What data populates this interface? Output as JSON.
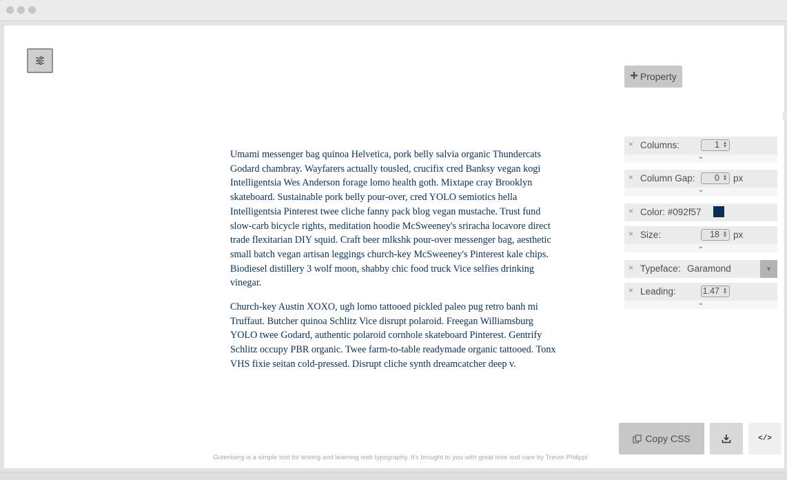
{
  "toolbar": {
    "add_property_label": "Property",
    "add_property_icon": "plus-icon",
    "settings_icon": "sliders-icon"
  },
  "content": {
    "paragraphs": [
      "Umami messenger bag quinoa Helvetica, pork belly salvia organic Thundercats Godard chambray. Wayfarers actually tousled, crucifix cred Banksy vegan kogi Intelligentsia Wes Anderson forage lomo health goth. Mixtape cray Brooklyn skateboard. Sustainable pork belly pour-over, cred YOLO semiotics hella Intelligentsia Pinterest twee cliche fanny pack blog vegan mustache. Trust fund slow-carb bicycle rights, meditation hoodie McSweeney's sriracha locavore direct trade flexitarian DIY squid. Craft beer mlkshk pour-over messenger bag, aesthetic small batch vegan artisan leggings church-key McSweeney's Pinterest kale chips. Biodiesel distillery 3 wolf moon, shabby chic food truck Vice selfies drinking vinegar.",
      "Church-key Austin XOXO, ugh lomo tattooed pickled paleo pug retro banh mi Truffaut. Butcher quinoa Schlitz Vice disrupt polaroid. Freegan Williamsburg YOLO twee Godard, authentic polaroid cornhole skateboard Pinterest. Gentrify Schlitz occupy PBR organic. Twee farm-to-table readymade organic tattooed. Tonx VHS fixie seitan cold-pressed. Disrupt cliche synth dreamcatcher deep v."
    ],
    "text_color": "#092f57"
  },
  "properties": {
    "remove_glyph": "×",
    "expand_glyph": "⌄",
    "columns": {
      "label": "Columns:",
      "value": "1"
    },
    "column_gap": {
      "label": "Column Gap:",
      "value": "0",
      "unit": "px"
    },
    "color": {
      "label": "Color: #092f57",
      "swatch": "#092f57"
    },
    "size": {
      "label": "Size:",
      "value": "18",
      "unit": "px"
    },
    "typeface": {
      "label": "Typeface:",
      "value": "Garamond"
    },
    "leading": {
      "label": "Leading:",
      "value": "1.47"
    }
  },
  "actions": {
    "copy_css_label": "Copy CSS",
    "copy_icon": "copy-icon",
    "download_icon": "download-icon",
    "code_label": "</>"
  },
  "footer": {
    "brand": "Gutenberg",
    "text": " is a simple tool for testing and learning web typography. It's brought to you with great love and care by ",
    "author": "Trevor Philippi"
  }
}
